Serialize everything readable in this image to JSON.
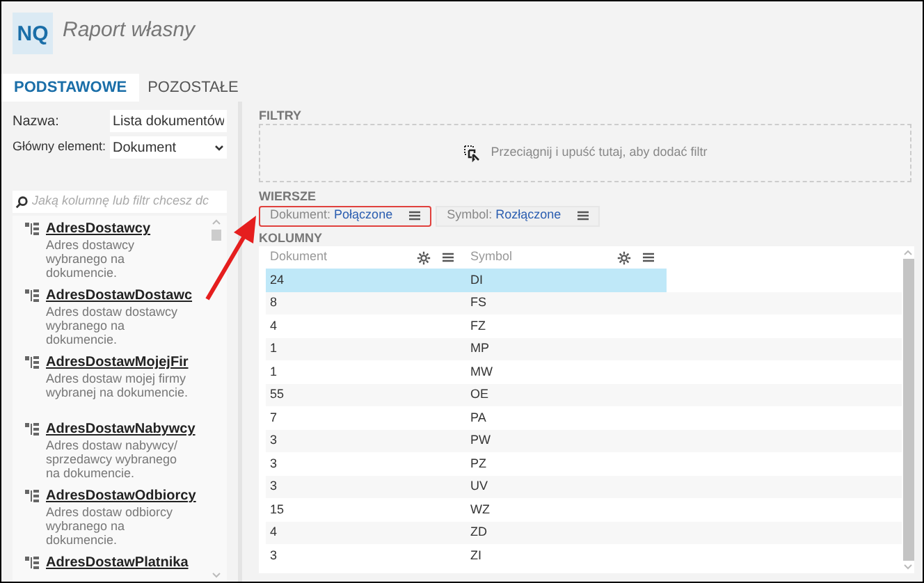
{
  "app": {
    "logo": "NQ",
    "title": "Raport własny"
  },
  "tabs": [
    {
      "label": "PODSTAWOWE",
      "selected": true
    },
    {
      "label": "POZOSTAŁE",
      "selected": false
    }
  ],
  "form": {
    "name_label": "Nazwa:",
    "name_value": "Lista dokumentów",
    "element_label": "Główny element:",
    "element_value": "Dokument"
  },
  "search": {
    "placeholder": "Jaką kolumnę lub filtr chcesz dc"
  },
  "fields": [
    {
      "title": "AdresDostawcy",
      "description": "Adres dostawcy wybranego na dokumencie."
    },
    {
      "title": "AdresDostawDostawc",
      "description": "Adres dostaw dostawcy wybranego na dokumencie."
    },
    {
      "title": "AdresDostawMojejFir",
      "description": "Adres dostaw mojej firmy wybranej na dokumencie."
    },
    {
      "title": "AdresDostawNabywcy",
      "description": "Adres dostaw nabywcy/ sprzedawcy wybranego na dokumencie."
    },
    {
      "title": "AdresDostawOdbiorcy",
      "description": "Adres dostaw odbiorcy wybranego na dokumencie."
    },
    {
      "title": "AdresDostawPlatnika"
    }
  ],
  "filters": {
    "heading": "FILTRY",
    "hint": "Przeciągnij i upuść tutaj, aby dodać filtr"
  },
  "rows_section": {
    "heading": "WIERSZE",
    "chips": [
      {
        "label": "Dokument:",
        "value": "Połączone",
        "highlighted": true
      },
      {
        "label": "Symbol:",
        "value": "Rozłączone",
        "highlighted": false
      }
    ]
  },
  "table": {
    "heading": "KOLUMNY",
    "columns": [
      "Dokument",
      "Symbol"
    ],
    "rows": [
      {
        "cells": [
          "24",
          "DI"
        ],
        "selected": true
      },
      {
        "cells": [
          "8",
          "FS"
        ],
        "selected": false
      },
      {
        "cells": [
          "4",
          "FZ"
        ],
        "selected": false
      },
      {
        "cells": [
          "1",
          "MP"
        ],
        "selected": false
      },
      {
        "cells": [
          "1",
          "MW"
        ],
        "selected": false
      },
      {
        "cells": [
          "55",
          "OE"
        ],
        "selected": false
      },
      {
        "cells": [
          "7",
          "PA"
        ],
        "selected": false
      },
      {
        "cells": [
          "3",
          "PW"
        ],
        "selected": false
      },
      {
        "cells": [
          "3",
          "PZ"
        ],
        "selected": false
      },
      {
        "cells": [
          "3",
          "UV"
        ],
        "selected": false
      },
      {
        "cells": [
          "15",
          "WZ"
        ],
        "selected": false
      },
      {
        "cells": [
          "4",
          "ZD"
        ],
        "selected": false
      },
      {
        "cells": [
          "3",
          "ZI"
        ],
        "selected": false
      }
    ]
  }
}
